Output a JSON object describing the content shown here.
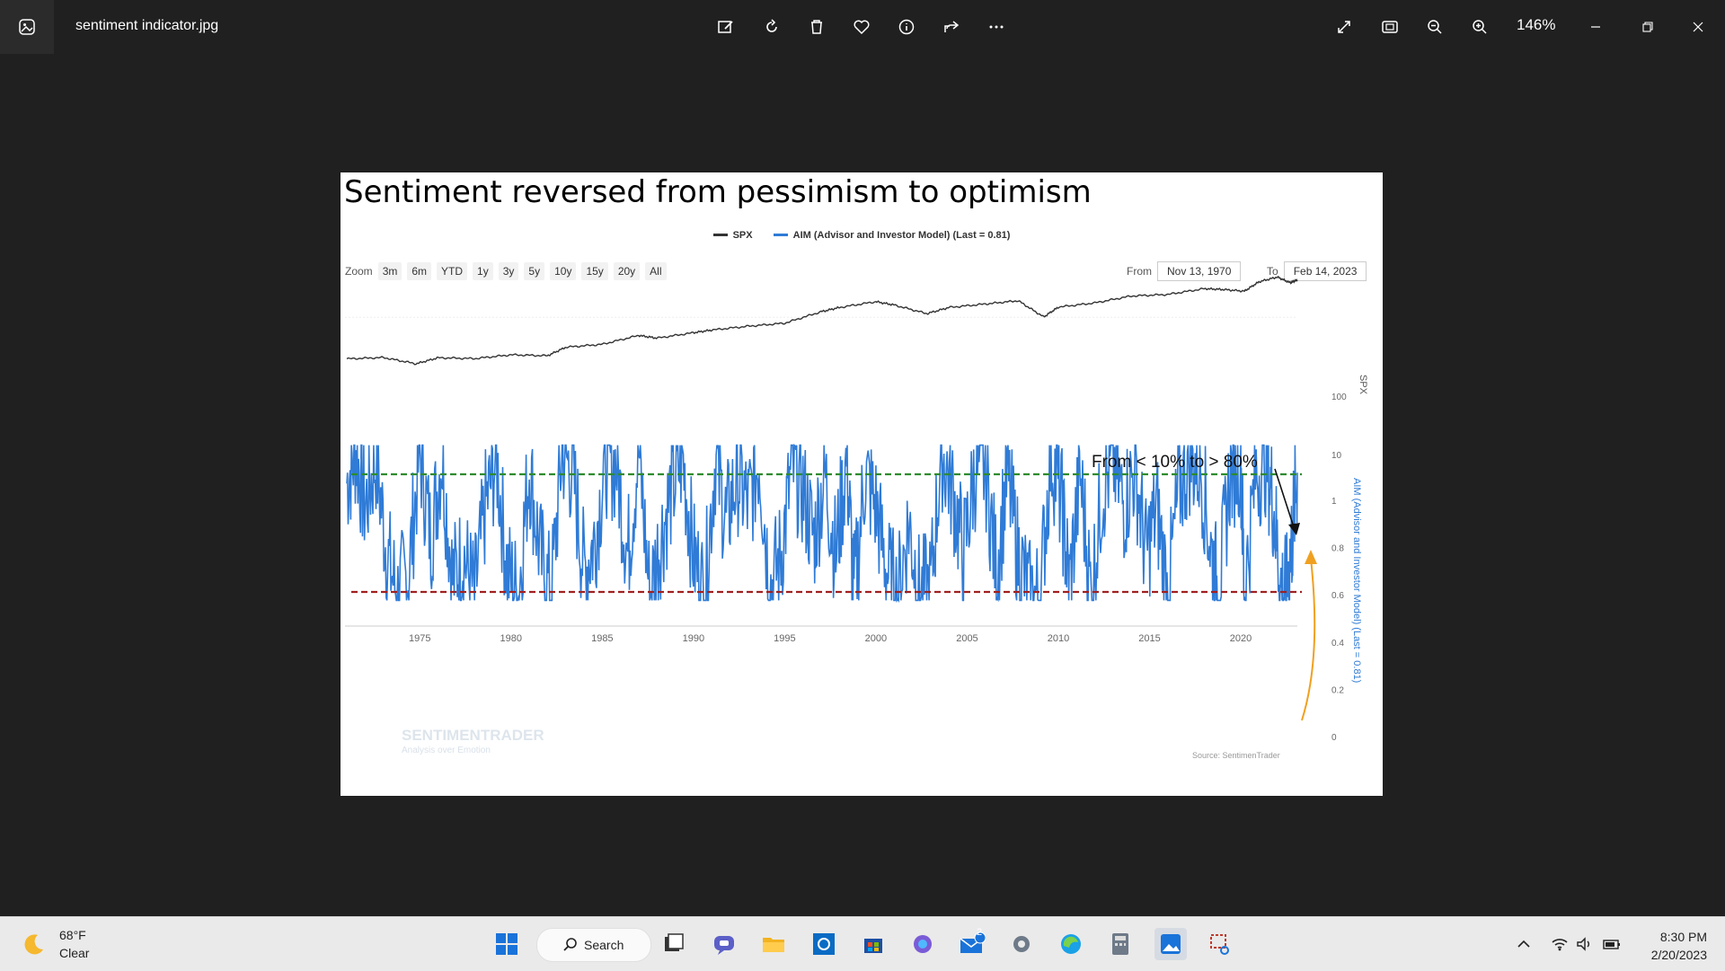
{
  "window": {
    "file_name": "sentiment indicator.jpg",
    "zoom_level": "146%"
  },
  "toolbar": {
    "icons": [
      "edit-image-icon",
      "rotate-icon",
      "delete-icon",
      "favorite-icon",
      "info-icon",
      "share-icon",
      "more-icon"
    ],
    "right_icons": [
      "expand-icon",
      "fit-window-icon",
      "zoom-out-icon",
      "zoom-in-icon"
    ]
  },
  "chart": {
    "title": "Sentiment reversed from pessimism to optimism",
    "legend": [
      {
        "name": "SPX",
        "color": "#333333"
      },
      {
        "name": "AIM (Advisor and Investor Model) (Last = 0.81)",
        "color": "#2f7bd6"
      }
    ],
    "zoom_label": "Zoom",
    "zoom_buttons": [
      "3m",
      "6m",
      "YTD",
      "1y",
      "3y",
      "5y",
      "10y",
      "15y",
      "20y",
      "All"
    ],
    "from_label": "From",
    "from_value": "Nov 13, 1970",
    "to_label": "To",
    "to_value": "Feb 14, 2023",
    "annotation": "From < 10% to > 80%",
    "source": "Source: SentimenTrader",
    "watermark": "SENTIMENTRADER",
    "watermark_sub": "Analysis over Emotion",
    "spx_axis_label": "SPX",
    "aim_axis_label": "AIM (Advisor and Investor Model) (Last = 0.81)"
  },
  "chart_data": {
    "type": "line",
    "x_ticks": [
      "1975",
      "1980",
      "1985",
      "1990",
      "1995",
      "2000",
      "2005",
      "2010",
      "2015",
      "2020"
    ],
    "spx_ticks": [
      "100",
      "10"
    ],
    "aim_ticks": [
      "1",
      "0.8",
      "0.6",
      "0.4",
      "0.2",
      "0"
    ],
    "aim_ylim": [
      0,
      1
    ],
    "x_range": [
      1970.9,
      2023.1
    ],
    "reference_lines": [
      {
        "value": 0.8,
        "color": "#2e8b2e",
        "style": "dashed"
      },
      {
        "value": 0.1,
        "color": "#a02020",
        "style": "dashed"
      }
    ],
    "series": [
      {
        "name": "SPX",
        "color": "#333333",
        "x": [
          1971,
          1973,
          1974.8,
          1976,
          1978,
          1980,
          1982,
          1983,
          1985,
          1987,
          1988,
          1990,
          1991,
          1993,
          1995,
          1997,
          1998,
          2000,
          2001,
          2002.8,
          2004,
          2006,
          2007.8,
          2009.2,
          2010,
          2012,
          2014,
          2016,
          2018,
          2019,
          2020.2,
          2021,
          2022,
          2022.7,
          2023.1
        ],
        "y": [
          95,
          101,
          75,
          100,
          96,
          115,
          110,
          165,
          190,
          290,
          255,
          330,
          375,
          450,
          520,
          900,
          1100,
          1450,
          1240,
          820,
          1100,
          1300,
          1520,
          700,
          1120,
          1370,
          1900,
          2050,
          2700,
          2600,
          2400,
          3750,
          4700,
          3600,
          4100
        ]
      },
      {
        "name": "AIM (Advisor and Investor Model) (Last = 0.81)",
        "color": "#2f7bd6",
        "x": [],
        "y": [],
        "note_generated": false
      }
    ],
    "aim_points": [
      [
        1971.0,
        0.75
      ],
      [
        1971.5,
        0.95
      ],
      [
        1972.0,
        0.6
      ],
      [
        1972.6,
        0.9
      ],
      [
        1973.2,
        0.3
      ],
      [
        1973.8,
        0.05
      ],
      [
        1974.4,
        0.2
      ],
      [
        1975.0,
        0.95
      ],
      [
        1975.6,
        0.4
      ],
      [
        1976.2,
        0.92
      ],
      [
        1976.8,
        0.15
      ],
      [
        1977.4,
        0.3
      ],
      [
        1978.0,
        0.05
      ],
      [
        1978.6,
        0.6
      ],
      [
        1979.2,
        0.9
      ],
      [
        1979.8,
        0.2
      ],
      [
        1980.4,
        0.05
      ],
      [
        1981.0,
        0.85
      ],
      [
        1981.6,
        0.3
      ],
      [
        1982.2,
        0.05
      ],
      [
        1982.8,
        0.95
      ],
      [
        1983.4,
        0.8
      ],
      [
        1984.0,
        0.2
      ],
      [
        1984.6,
        0.4
      ],
      [
        1985.2,
        0.9
      ],
      [
        1985.8,
        0.85
      ],
      [
        1986.4,
        0.3
      ],
      [
        1987.0,
        0.95
      ],
      [
        1987.6,
        0.05
      ],
      [
        1988.2,
        0.4
      ],
      [
        1988.8,
        0.7
      ],
      [
        1989.4,
        0.9
      ],
      [
        1990.0,
        0.3
      ],
      [
        1990.6,
        0.05
      ],
      [
        1991.2,
        0.9
      ],
      [
        1991.8,
        0.5
      ],
      [
        1992.4,
        0.8
      ],
      [
        1993.0,
        0.6
      ],
      [
        1993.6,
        0.9
      ],
      [
        1994.2,
        0.1
      ],
      [
        1994.8,
        0.3
      ],
      [
        1995.4,
        0.85
      ],
      [
        1996.0,
        0.7
      ],
      [
        1996.6,
        0.4
      ],
      [
        1997.2,
        0.8
      ],
      [
        1997.8,
        0.3
      ],
      [
        1998.4,
        0.9
      ],
      [
        1998.8,
        0.05
      ],
      [
        1999.4,
        0.8
      ],
      [
        2000.0,
        0.6
      ],
      [
        2000.6,
        0.2
      ],
      [
        2001.2,
        0.05
      ],
      [
        2001.8,
        0.5
      ],
      [
        2002.4,
        0.05
      ],
      [
        2003.0,
        0.1
      ],
      [
        2003.6,
        0.95
      ],
      [
        2004.2,
        0.7
      ],
      [
        2004.8,
        0.3
      ],
      [
        2005.4,
        0.8
      ],
      [
        2006.0,
        0.85
      ],
      [
        2006.6,
        0.2
      ],
      [
        2007.2,
        0.8
      ],
      [
        2007.8,
        0.3
      ],
      [
        2008.4,
        0.05
      ],
      [
        2009.0,
        0.05
      ],
      [
        2009.6,
        0.95
      ],
      [
        2010.2,
        0.6
      ],
      [
        2010.6,
        0.1
      ],
      [
        2011.2,
        0.8
      ],
      [
        2011.8,
        0.05
      ],
      [
        2012.4,
        0.7
      ],
      [
        2013.0,
        0.9
      ],
      [
        2013.6,
        0.6
      ],
      [
        2014.2,
        0.85
      ],
      [
        2014.8,
        0.3
      ],
      [
        2015.4,
        0.6
      ],
      [
        2016.0,
        0.05
      ],
      [
        2016.6,
        0.7
      ],
      [
        2017.2,
        0.9
      ],
      [
        2017.8,
        0.85
      ],
      [
        2018.4,
        0.3
      ],
      [
        2018.8,
        0.05
      ],
      [
        2019.4,
        0.8
      ],
      [
        2020.0,
        0.9
      ],
      [
        2020.2,
        0.05
      ],
      [
        2020.8,
        0.8
      ],
      [
        2021.4,
        0.9
      ],
      [
        2021.8,
        0.6
      ],
      [
        2022.2,
        0.1
      ],
      [
        2022.5,
        0.05
      ],
      [
        2022.8,
        0.4
      ],
      [
        2023.1,
        0.81
      ]
    ]
  },
  "taskbar": {
    "weather_temp": "68°F",
    "weather_desc": "Clear",
    "search_label": "Search",
    "mail_badge": "2",
    "time": "8:30 PM",
    "date": "2/20/2023"
  }
}
